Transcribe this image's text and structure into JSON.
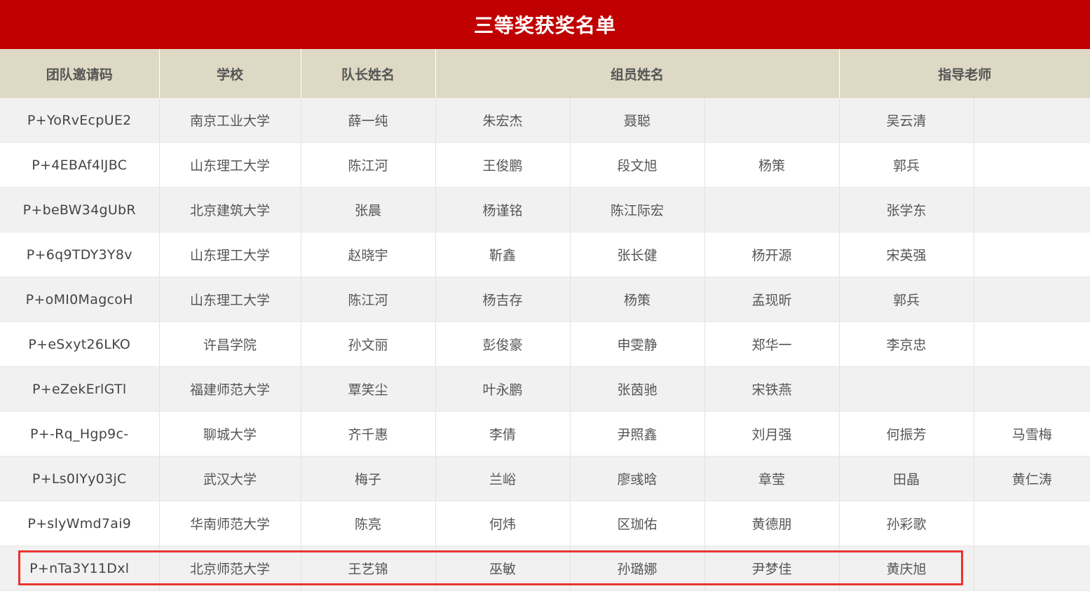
{
  "title": "三等奖获奖名单",
  "colors": {
    "title_bg": "#c00000",
    "header_bg": "#ddd9c4",
    "row_alt_bg": "#f1f1f1",
    "highlight": "#e8352f"
  },
  "headers": {
    "code": "团队邀请码",
    "school": "学校",
    "captain": "队长姓名",
    "members": "组员姓名",
    "advisors": "指导老师"
  },
  "rows": [
    {
      "code": "P+YoRvEcpUE2",
      "school": "南京工业大学",
      "captain": "薛一纯",
      "m1": "朱宏杰",
      "m2": "聂聪",
      "m3": "",
      "a1": "吴云清",
      "a2": ""
    },
    {
      "code": "P+4EBAf4lJBC",
      "school": "山东理工大学",
      "captain": "陈江河",
      "m1": "王俊鹏",
      "m2": "段文旭",
      "m3": "杨策",
      "a1": "郭兵",
      "a2": ""
    },
    {
      "code": "P+beBW34gUbR",
      "school": "北京建筑大学",
      "captain": "张晨",
      "m1": "杨谨铭",
      "m2": "陈江际宏",
      "m3": "",
      "a1": "张学东",
      "a2": ""
    },
    {
      "code": "P+6q9TDY3Y8v",
      "school": "山东理工大学",
      "captain": "赵晓宇",
      "m1": "靳鑫",
      "m2": "张长健",
      "m3": "杨开源",
      "a1": "宋英强",
      "a2": ""
    },
    {
      "code": "P+oMI0MagcoH",
      "school": "山东理工大学",
      "captain": "陈江河",
      "m1": "杨吉存",
      "m2": "杨策",
      "m3": "孟现昕",
      "a1": "郭兵",
      "a2": ""
    },
    {
      "code": "P+eSxyt26LKO",
      "school": "许昌学院",
      "captain": "孙文丽",
      "m1": "彭俊豪",
      "m2": "申雯静",
      "m3": "郑华一",
      "a1": "李京忠",
      "a2": ""
    },
    {
      "code": "P+eZekErlGTl",
      "school": "福建师范大学",
      "captain": "覃笑尘",
      "m1": "叶永鹏",
      "m2": "张茵驰",
      "m3": "宋铁燕",
      "a1": "",
      "a2": ""
    },
    {
      "code": "P+-Rq_Hgp9c-",
      "school": "聊城大学",
      "captain": "齐千惠",
      "m1": "李倩",
      "m2": "尹照鑫",
      "m3": "刘月强",
      "a1": "何振芳",
      "a2": "马雪梅"
    },
    {
      "code": "P+Ls0IYy03jC",
      "school": "武汉大学",
      "captain": "梅子",
      "m1": "兰峪",
      "m2": "廖彧晗",
      "m3": "章莹",
      "a1": "田晶",
      "a2": "黄仁涛"
    },
    {
      "code": "P+slyWmd7ai9",
      "school": "华南师范大学",
      "captain": "陈亮",
      "m1": "何炜",
      "m2": "区珈佑",
      "m3": "黄德朋",
      "a1": "孙彩歌",
      "a2": ""
    },
    {
      "code": "P+nTa3Y11Dxl",
      "school": "北京师范大学",
      "captain": "王艺锦",
      "m1": "巫敏",
      "m2": "孙璐娜",
      "m3": "尹梦佳",
      "a1": "黄庆旭",
      "a2": ""
    }
  ]
}
